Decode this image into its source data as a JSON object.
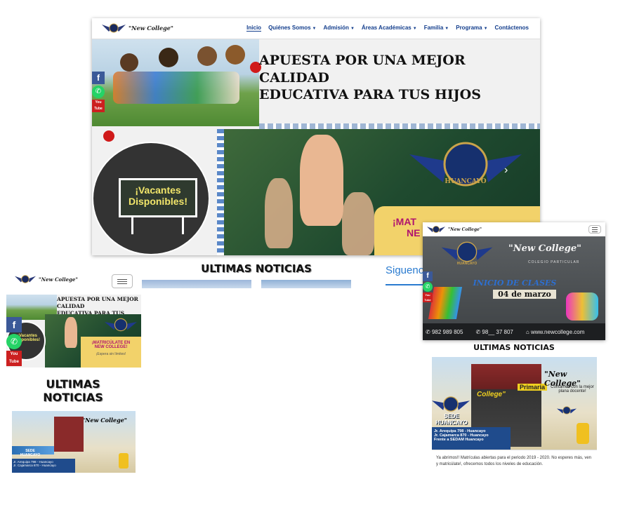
{
  "desktop": {
    "logo_text": "\"New College\"",
    "nav": [
      "Inicio",
      "Quiénes Somos",
      "Admisión",
      "Áreas Académicas",
      "Familia",
      "Programa",
      "Contáctenos"
    ],
    "nav_active": "Inicio",
    "hero_title_line1": "APUESTA POR UNA MEJOR CALIDAD",
    "hero_title_line2": "EDUCATIVA PARA TUS HIJOS",
    "crest_label": "HUANCAYO",
    "vacantes_line1": "¡Vacantes",
    "vacantes_line2": "Disponibles!",
    "banner_partial_1": "¡MAT",
    "banner_partial_2": "NE",
    "news_heading": "ULTIMAS NOTICIAS",
    "follow_label": "Siguenos"
  },
  "mobile": {
    "logo_text": "\"New College\"",
    "hero_title_line1": "APUESTA POR UNA MEJOR CALIDAD",
    "hero_title_line2": "EDUCATIVA PARA TUS HIJOS",
    "vacantes": "¡Vacantes Disponibles!",
    "banner_line1": "¡MATRICÚLATE EN",
    "banner_line2": "NEW COLLEGE!",
    "banner_line3": "¡Espera sin límites!",
    "news_heading_line1": "ULTIMAS",
    "news_heading_line2": "NOTICIAS",
    "card_brand": "\"New College\"",
    "card_sede_1": "SEDE",
    "card_sede_2": "HUANCAYO",
    "card_addr_1": "Jr. Arequipa 798 - Huancayo",
    "card_addr_2": "Jr. Cajamarca 870 - Huancayo"
  },
  "tablet": {
    "logo_text": "\"New College\"",
    "header_brand": "\"New College\"",
    "header_sub": "COLEGIO PARTICULAR",
    "crest_label": "HUANCAYO",
    "inicio_line1": "INICIO DE CLASES",
    "inicio_line2": "04 de marzo",
    "phone1": "982 989 805",
    "phone2": "98__ 37 807",
    "website": "www.newcollege.com",
    "news_heading": "ULTIMAS NOTICIAS",
    "card_brand": "\"New College\"",
    "card_tagline": "Contamos con la mejor plana docente!",
    "card_sede_1": "SEDE",
    "card_sede_2": "HUANCAYO",
    "card_primaria": "Primaria",
    "card_college": "College\"",
    "card_addr_1": "Jr. Arequipa 798 - Huancayo",
    "card_addr_2": "Jr. Cajamarca 870 - Huancayo",
    "card_addr_3": "Frente a SEDAM Huancayo",
    "news_text": "Ya abrimos!! Matrículas abiertas para el periodo 2019 - 2020. No esperes más, ven y matricúlate!, ofrecemos todos los niveles de educación."
  },
  "colors": {
    "nav_text": "#123d8c",
    "facebook": "#3b5998",
    "whatsapp": "#25d366",
    "youtube": "#cc2020",
    "banner": "#f2d26a",
    "magenta": "#b0136f"
  },
  "icons": [
    "wings-logo-icon",
    "facebook-icon",
    "whatsapp-icon",
    "youtube-icon",
    "hamburger-icon",
    "phone-icon",
    "globe-icon"
  ]
}
